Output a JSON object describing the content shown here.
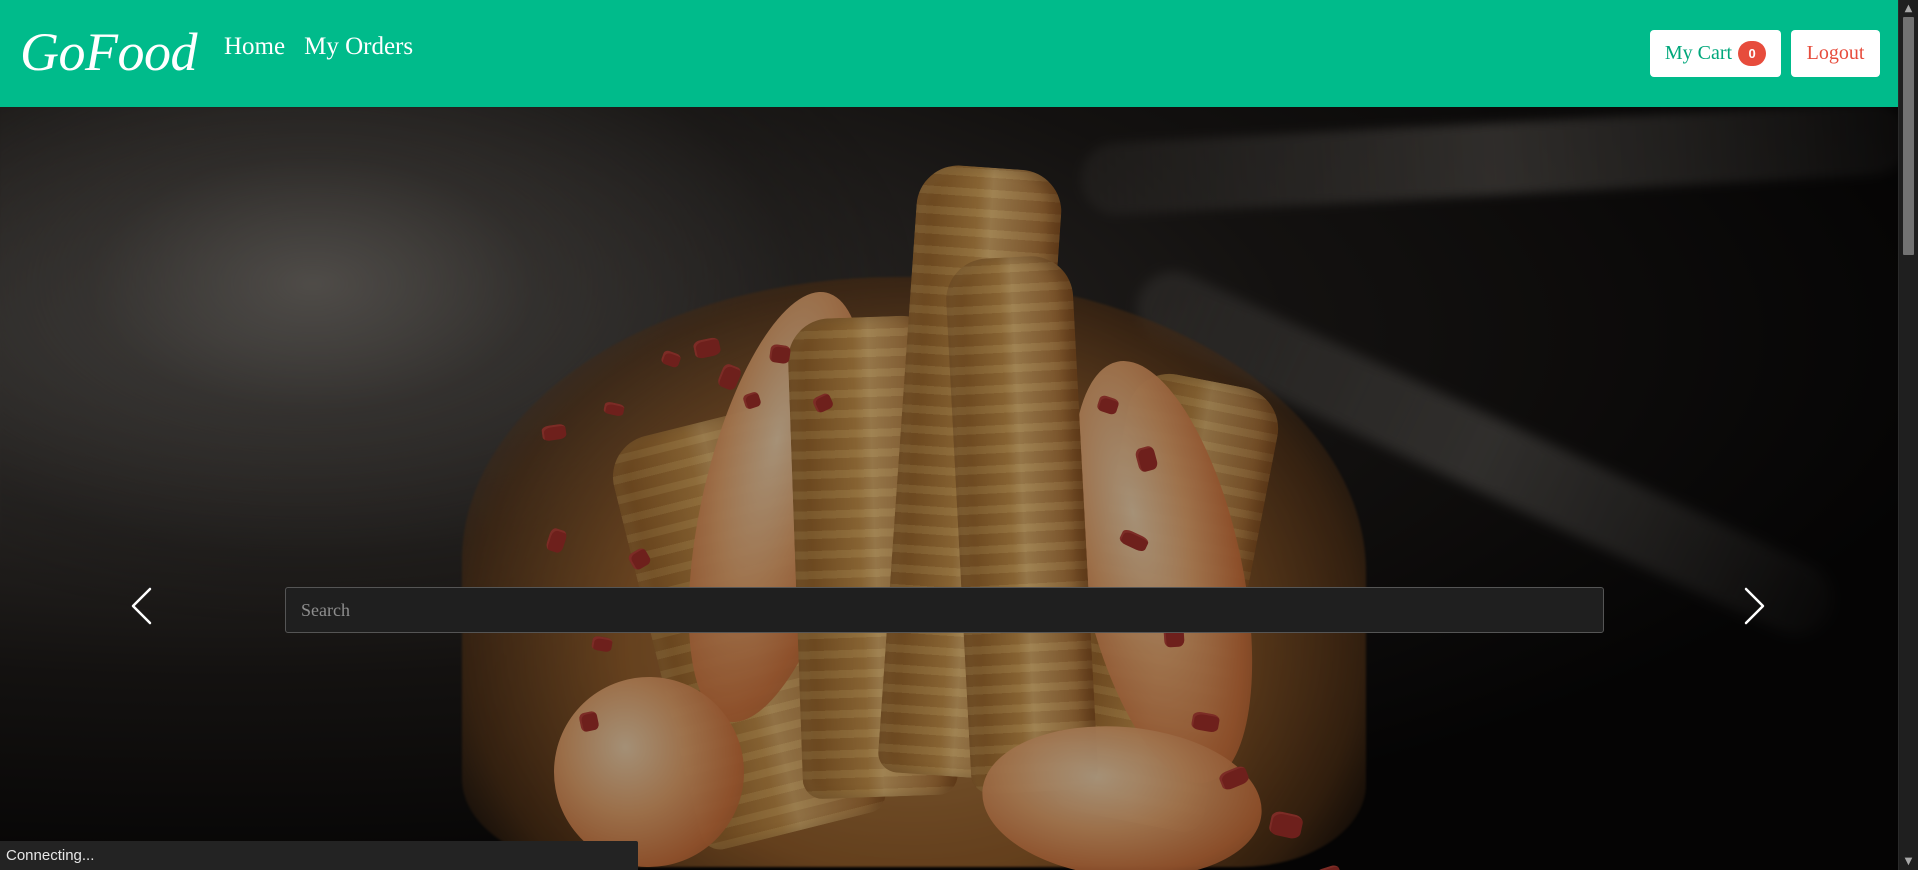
{
  "navbar": {
    "brand": "GoFood",
    "links": [
      {
        "label": "Home"
      },
      {
        "label": "My Orders"
      }
    ],
    "cart": {
      "label": "My Cart",
      "count": "0"
    },
    "logout_label": "Logout"
  },
  "hero": {
    "search": {
      "placeholder": "Search",
      "value": ""
    },
    "controls": {
      "previous_icon": "chevron-left-icon",
      "next_icon": "chevron-right-icon"
    }
  },
  "browser": {
    "status": "Connecting..."
  },
  "colors": {
    "navbar": "#00bb8b",
    "cart_text": "#00a77b",
    "badge": "#e74c3c",
    "logout_text": "#e74c3c",
    "search_background": "#1f1f1f",
    "status_background": "#232323"
  }
}
